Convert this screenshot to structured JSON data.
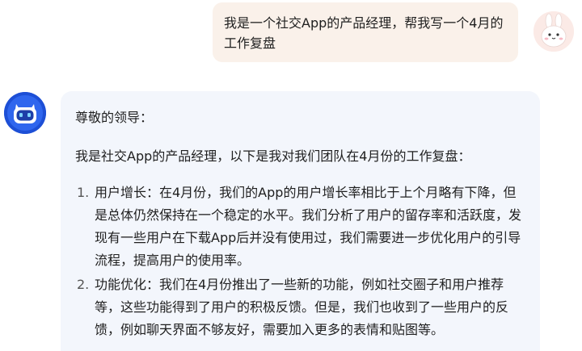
{
  "user_message": {
    "text": "我是一个社交App的产品经理，帮我写一个4月的工作复盘",
    "avatar_icon": "bunny-avatar-icon"
  },
  "bot_message": {
    "avatar_icon": "robot-avatar-icon",
    "accent_color": "#1d4fd6",
    "greeting": "尊敬的领导：",
    "intro": "我是社交App的产品经理，以下是我对我们团队在4月份的工作复盘：",
    "items": [
      {
        "number": "1.",
        "text": "用户增长：在4月份，我们的App的用户增长率相比于上个月略有下降，但是总体仍然保持在一个稳定的水平。我们分析了用户的留存率和活跃度，发现有一些用户在下载App后并没有使用过，我们需要进一步优化用户的引导流程，提高用户的使用率。"
      },
      {
        "number": "2.",
        "text": "功能优化：我们在4月份推出了一些新的功能，例如社交圈子和用户推荐等，这些功能得到了用户的积极反馈。但是，我们也收到了一些用户的反馈，例如聊天界面不够友好，需要加入更多的表情和贴图等。"
      }
    ]
  }
}
